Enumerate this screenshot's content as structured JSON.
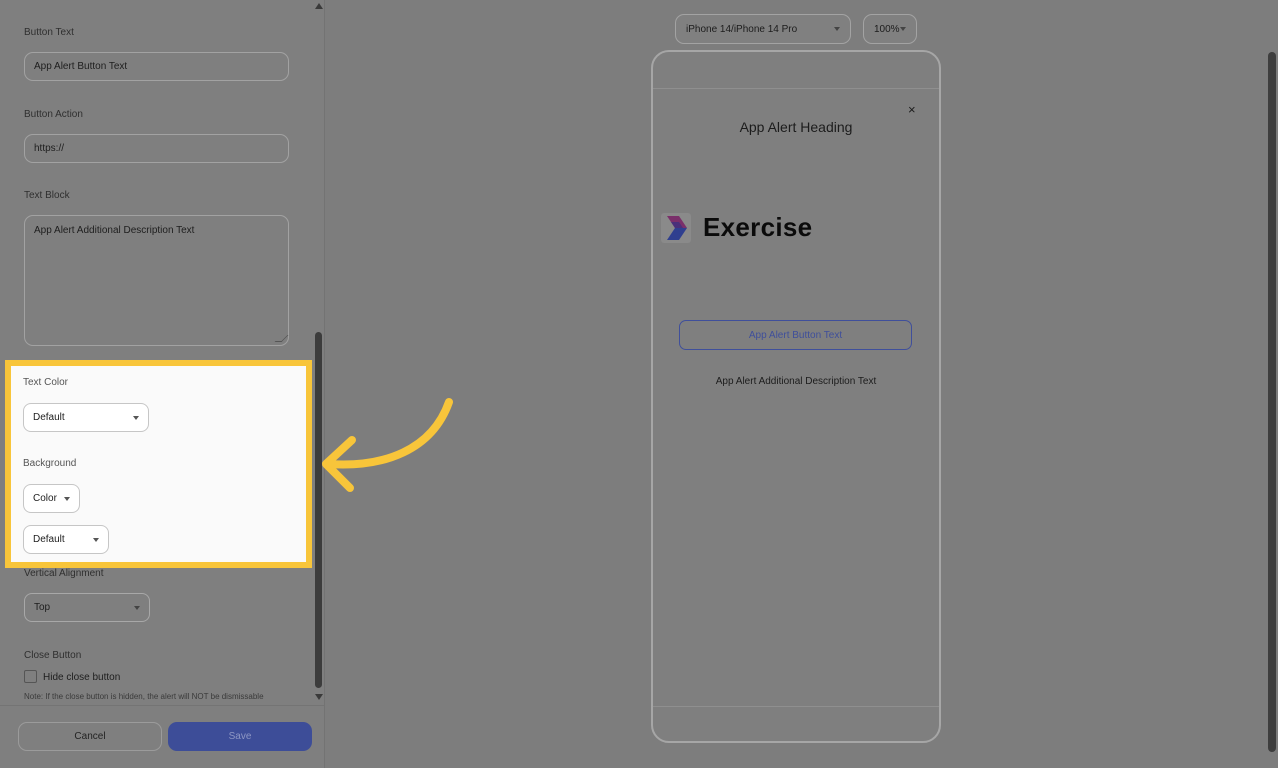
{
  "editor": {
    "button_text": {
      "label": "Button Text",
      "value": "App Alert Button Text"
    },
    "button_action": {
      "label": "Button Action",
      "value": "https://"
    },
    "text_block": {
      "label": "Text Block",
      "value": "App Alert Additional Description Text"
    },
    "text_color": {
      "label": "Text Color",
      "value": "Default"
    },
    "background": {
      "label": "Background",
      "type_value": "Color",
      "color_value": "Default"
    },
    "vertical_alignment": {
      "label": "Vertical Alignment",
      "value": "Top"
    },
    "close_button": {
      "label": "Close Button",
      "checkbox_label": "Hide close button",
      "checked": false,
      "note": "Note: If the close button is hidden, the alert will NOT be dismissable"
    }
  },
  "footer": {
    "cancel_label": "Cancel",
    "save_label": "Save"
  },
  "preview": {
    "device": "iPhone 14/iPhone 14 Pro",
    "zoom": "100%",
    "close_glyph": "×",
    "alert_heading": "App Alert Heading",
    "logo_text": "Exercise",
    "button_text": "App Alert Button Text",
    "description": "App Alert Additional Description Text"
  },
  "colors": {
    "highlight_border": "#f8c53a",
    "accent": "#3f4f9b",
    "overlay": "#7f7f7f"
  },
  "icons": [
    "chevron-down-icon",
    "close-icon",
    "scroll-up-icon",
    "scroll-down-icon",
    "annotation-arrow-icon",
    "exercise-logo-icon"
  ]
}
